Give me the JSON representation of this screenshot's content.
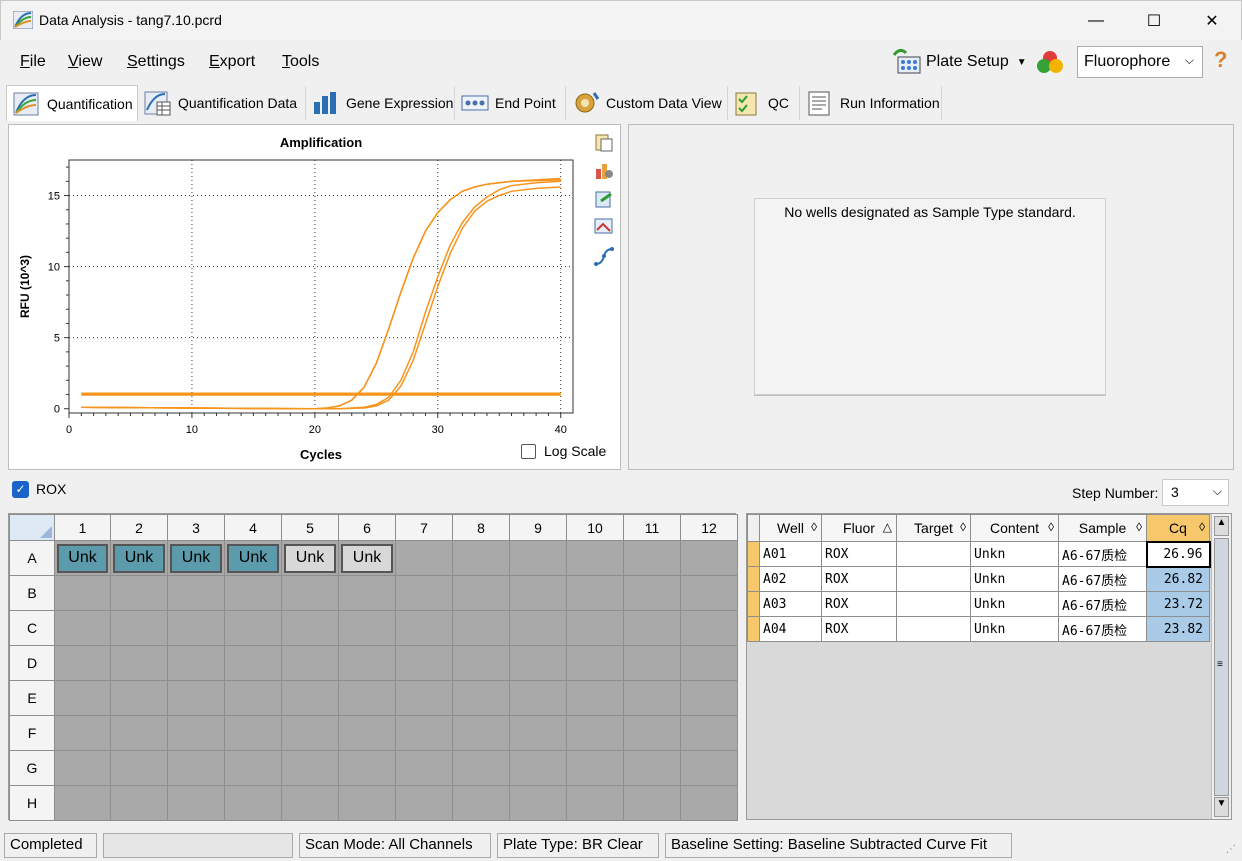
{
  "window": {
    "title": "Data Analysis - tang7.10.pcrd",
    "minimize": "—",
    "maximize": "☐",
    "close": "✕"
  },
  "menu": [
    {
      "label": "File",
      "key": "F"
    },
    {
      "label": "View",
      "key": "V"
    },
    {
      "label": "Settings",
      "key": "S"
    },
    {
      "label": "Export",
      "key": "E"
    },
    {
      "label": "Tools",
      "key": "T"
    }
  ],
  "toolbar": {
    "plate_setup": "Plate Setup",
    "fluorophore": "Fluorophore",
    "help": "?"
  },
  "tabs": [
    {
      "label": "Quantification",
      "icon": "amplification-icon",
      "active": true
    },
    {
      "label": "Quantification Data",
      "icon": "quant-data-icon"
    },
    {
      "label": "Gene Expression",
      "icon": "bar-chart-icon"
    },
    {
      "label": "End Point",
      "icon": "end-point-icon"
    },
    {
      "label": "Custom Data View",
      "icon": "gear-icon"
    },
    {
      "label": "QC",
      "icon": "checklist-icon"
    },
    {
      "label": "Run Information",
      "icon": "document-icon"
    }
  ],
  "chart_data": {
    "type": "line",
    "title": "Amplification",
    "xlabel": "Cycles",
    "ylabel": "RFU (10^3)",
    "xlim": [
      0,
      41
    ],
    "ylim": [
      -0.3,
      17.5
    ],
    "xticks": [
      0,
      10,
      20,
      30,
      40
    ],
    "yticks": [
      0,
      5,
      10,
      15
    ],
    "grid": true,
    "log_scale_label": "Log Scale",
    "log_scale": false,
    "series": [
      {
        "x": [
          1,
          5,
          10,
          15,
          18,
          20,
          21,
          22,
          23,
          24,
          25,
          26,
          27,
          28,
          29,
          30,
          31,
          32,
          33,
          34,
          35,
          36,
          38,
          40
        ],
        "y": [
          0.1,
          0.08,
          0.05,
          0.02,
          0,
          0,
          0.05,
          0.2,
          0.6,
          1.5,
          3.2,
          5.6,
          8.2,
          10.6,
          12.5,
          13.8,
          14.7,
          15.3,
          15.6,
          15.8,
          15.9,
          16,
          16.1,
          16.2
        ]
      },
      {
        "x": [
          1,
          5,
          10,
          15,
          18,
          20,
          21,
          22,
          23,
          24,
          25,
          26,
          27,
          28,
          29,
          30,
          31,
          32,
          33,
          34,
          35,
          36,
          38,
          40
        ],
        "y": [
          0.1,
          0.08,
          0.05,
          0.02,
          0,
          0,
          0.05,
          0.2,
          0.6,
          1.5,
          3.2,
          5.6,
          8.2,
          10.6,
          12.5,
          13.8,
          14.7,
          15.3,
          15.6,
          15.8,
          15.9,
          16,
          16.05,
          16.1
        ]
      },
      {
        "x": [
          1,
          10,
          20,
          22,
          24,
          25,
          26,
          27,
          28,
          29,
          30,
          31,
          32,
          33,
          34,
          35,
          36,
          38,
          40
        ],
        "y": [
          0.1,
          0.05,
          0,
          0,
          0.1,
          0.3,
          0.8,
          2,
          4,
          6.8,
          9.3,
          11.5,
          13.1,
          14.2,
          14.9,
          15.4,
          15.7,
          15.9,
          16
        ]
      },
      {
        "x": [
          1,
          10,
          20,
          22,
          24,
          25,
          26,
          27,
          28,
          29,
          30,
          31,
          32,
          33,
          34,
          35,
          36,
          38,
          40
        ],
        "y": [
          0.1,
          0.05,
          0,
          0,
          0.05,
          0.2,
          0.6,
          1.6,
          3.4,
          6,
          8.6,
          10.9,
          12.7,
          13.9,
          14.6,
          15,
          15.3,
          15.5,
          15.6
        ]
      },
      {
        "x": [
          1,
          40
        ],
        "y": [
          1,
          1
        ]
      },
      {
        "x": [
          1,
          40
        ],
        "y": [
          1.05,
          1.05
        ]
      }
    ],
    "color": "#f7941d"
  },
  "standard_message": "No wells designated as Sample Type standard.",
  "rox": {
    "label": "ROX",
    "checked": true
  },
  "step": {
    "label": "Step Number:",
    "value": "3"
  },
  "plate": {
    "columns": [
      "1",
      "2",
      "3",
      "4",
      "5",
      "6",
      "7",
      "8",
      "9",
      "10",
      "11",
      "12"
    ],
    "rows": [
      "A",
      "B",
      "C",
      "D",
      "E",
      "F",
      "G",
      "H"
    ],
    "row_a": [
      "Unk",
      "Unk",
      "Unk",
      "Unk",
      "Unk",
      "Unk"
    ]
  },
  "wells_table": {
    "headers": [
      {
        "label": "Well",
        "sort": "◊"
      },
      {
        "label": "Fluor",
        "sort": "△"
      },
      {
        "label": "Target",
        "sort": "◊"
      },
      {
        "label": "Content",
        "sort": "◊"
      },
      {
        "label": "Sample",
        "sort": "◊"
      },
      {
        "label": "Cq",
        "sort": "◊"
      }
    ],
    "rows": [
      [
        "A01",
        "ROX",
        "",
        "Unkn",
        "A6-67质检",
        "26.96"
      ],
      [
        "A02",
        "ROX",
        "",
        "Unkn",
        "A6-67质检",
        "26.82"
      ],
      [
        "A03",
        "ROX",
        "",
        "Unkn",
        "A6-67质检",
        "23.72"
      ],
      [
        "A04",
        "ROX",
        "",
        "Unkn",
        "A6-67质检",
        "23.82"
      ]
    ]
  },
  "status": {
    "state": "Completed",
    "scan_mode": "Scan Mode: All Channels",
    "plate_type": "Plate Type: BR Clear",
    "baseline": "Baseline Setting: Baseline Subtracted Curve Fit"
  }
}
